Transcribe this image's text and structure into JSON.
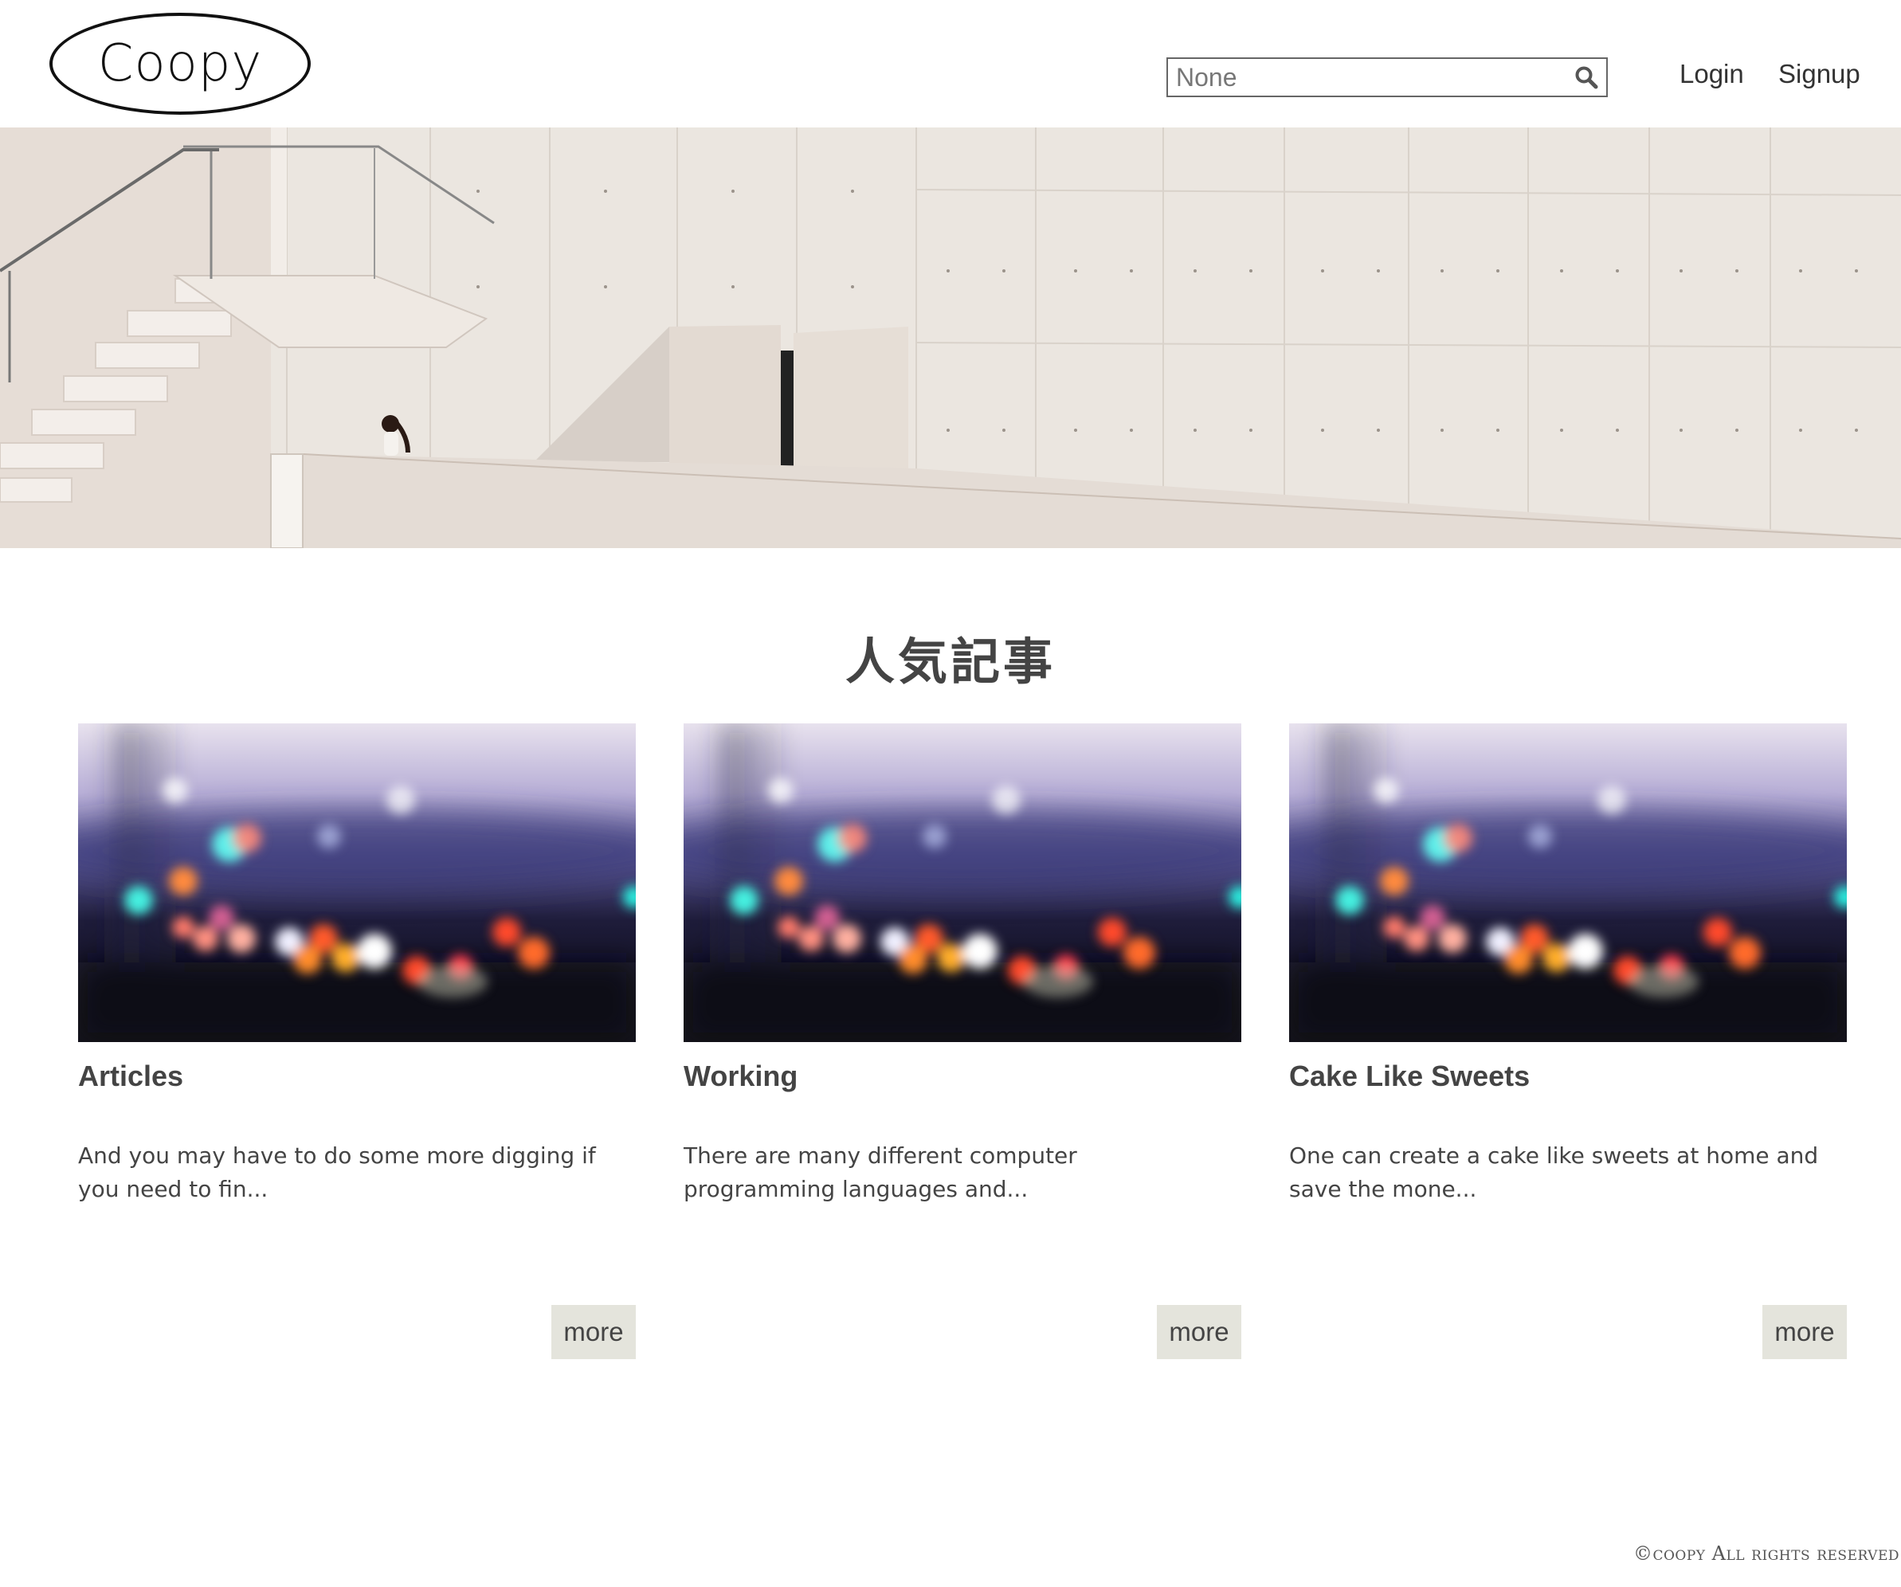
{
  "header": {
    "logo_text": "Coopy",
    "search_value": "None",
    "search_icon": "search-icon",
    "nav": {
      "login": "Login",
      "signup": "Signup"
    }
  },
  "hero": {
    "image": "hero-photo: white concrete building with staircase and a person"
  },
  "popular": {
    "title": "人気記事",
    "cards": [
      {
        "title": "Articles",
        "excerpt": "And you may have to do some more digging if you need to fin...",
        "more_label": "more"
      },
      {
        "title": "Working",
        "excerpt": "There are many different computer programming languages and...",
        "more_label": "more"
      },
      {
        "title": "Cake Like Sweets",
        "excerpt": "One can create a cake like sweets at home and save the mone...",
        "more_label": "more"
      }
    ]
  },
  "footer": {
    "copyright": "©coopy All rights reserved"
  },
  "colors": {
    "more_button_bg": "#e4e4dc",
    "text": "#444444"
  }
}
